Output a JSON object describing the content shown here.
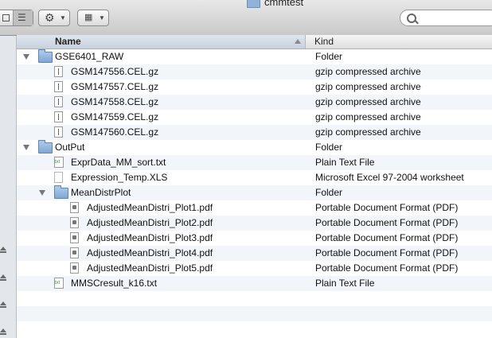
{
  "window": {
    "title": "cmmtest"
  },
  "toolbar": {
    "action_icon": "gear-icon",
    "arrange_icon": "grid-icon",
    "search_icon": "search-icon"
  },
  "columns": {
    "name": "Name",
    "kind": "Kind"
  },
  "rows": [
    {
      "name": "GSE6401_RAW",
      "kind": "Folder",
      "icon": "folder",
      "level": 0,
      "expanded": true
    },
    {
      "name": "GSM147556.CEL.gz",
      "kind": "gzip compressed archive",
      "icon": "doc",
      "level": 1
    },
    {
      "name": "GSM147557.CEL.gz",
      "kind": "gzip compressed archive",
      "icon": "doc",
      "level": 1
    },
    {
      "name": "GSM147558.CEL.gz",
      "kind": "gzip compressed archive",
      "icon": "doc",
      "level": 1
    },
    {
      "name": "GSM147559.CEL.gz",
      "kind": "gzip compressed archive",
      "icon": "doc",
      "level": 1
    },
    {
      "name": "GSM147560.CEL.gz",
      "kind": "gzip compressed archive",
      "icon": "doc",
      "level": 1
    },
    {
      "name": "OutPut",
      "kind": "Folder",
      "icon": "folder",
      "level": 0,
      "expanded": true
    },
    {
      "name": "ExprData_MM_sort.txt",
      "kind": "Plain Text File",
      "icon": "txt",
      "level": 1
    },
    {
      "name": "Expression_Temp.XLS",
      "kind": "Microsoft Excel 97-2004 worksheet",
      "icon": "plain",
      "level": 1
    },
    {
      "name": "MeanDistrPlot",
      "kind": "Folder",
      "icon": "folder",
      "level": 1,
      "expanded": true
    },
    {
      "name": "AdjustedMeanDistri_Plot1.pdf",
      "kind": "Portable Document Format (PDF)",
      "icon": "pdf",
      "level": 2
    },
    {
      "name": "AdjustedMeanDistri_Plot2.pdf",
      "kind": "Portable Document Format (PDF)",
      "icon": "pdf",
      "level": 2
    },
    {
      "name": "AdjustedMeanDistri_Plot3.pdf",
      "kind": "Portable Document Format (PDF)",
      "icon": "pdf",
      "level": 2
    },
    {
      "name": "AdjustedMeanDistri_Plot4.pdf",
      "kind": "Portable Document Format (PDF)",
      "icon": "pdf",
      "level": 2
    },
    {
      "name": "AdjustedMeanDistri_Plot5.pdf",
      "kind": "Portable Document Format (PDF)",
      "icon": "pdf",
      "level": 2
    },
    {
      "name": "MMSCresult_k16.txt",
      "kind": "Plain Text File",
      "icon": "txt",
      "level": 1
    }
  ],
  "colors": {
    "alt_row": "#f2f5f9",
    "header_selected": "#c7d1dd"
  }
}
